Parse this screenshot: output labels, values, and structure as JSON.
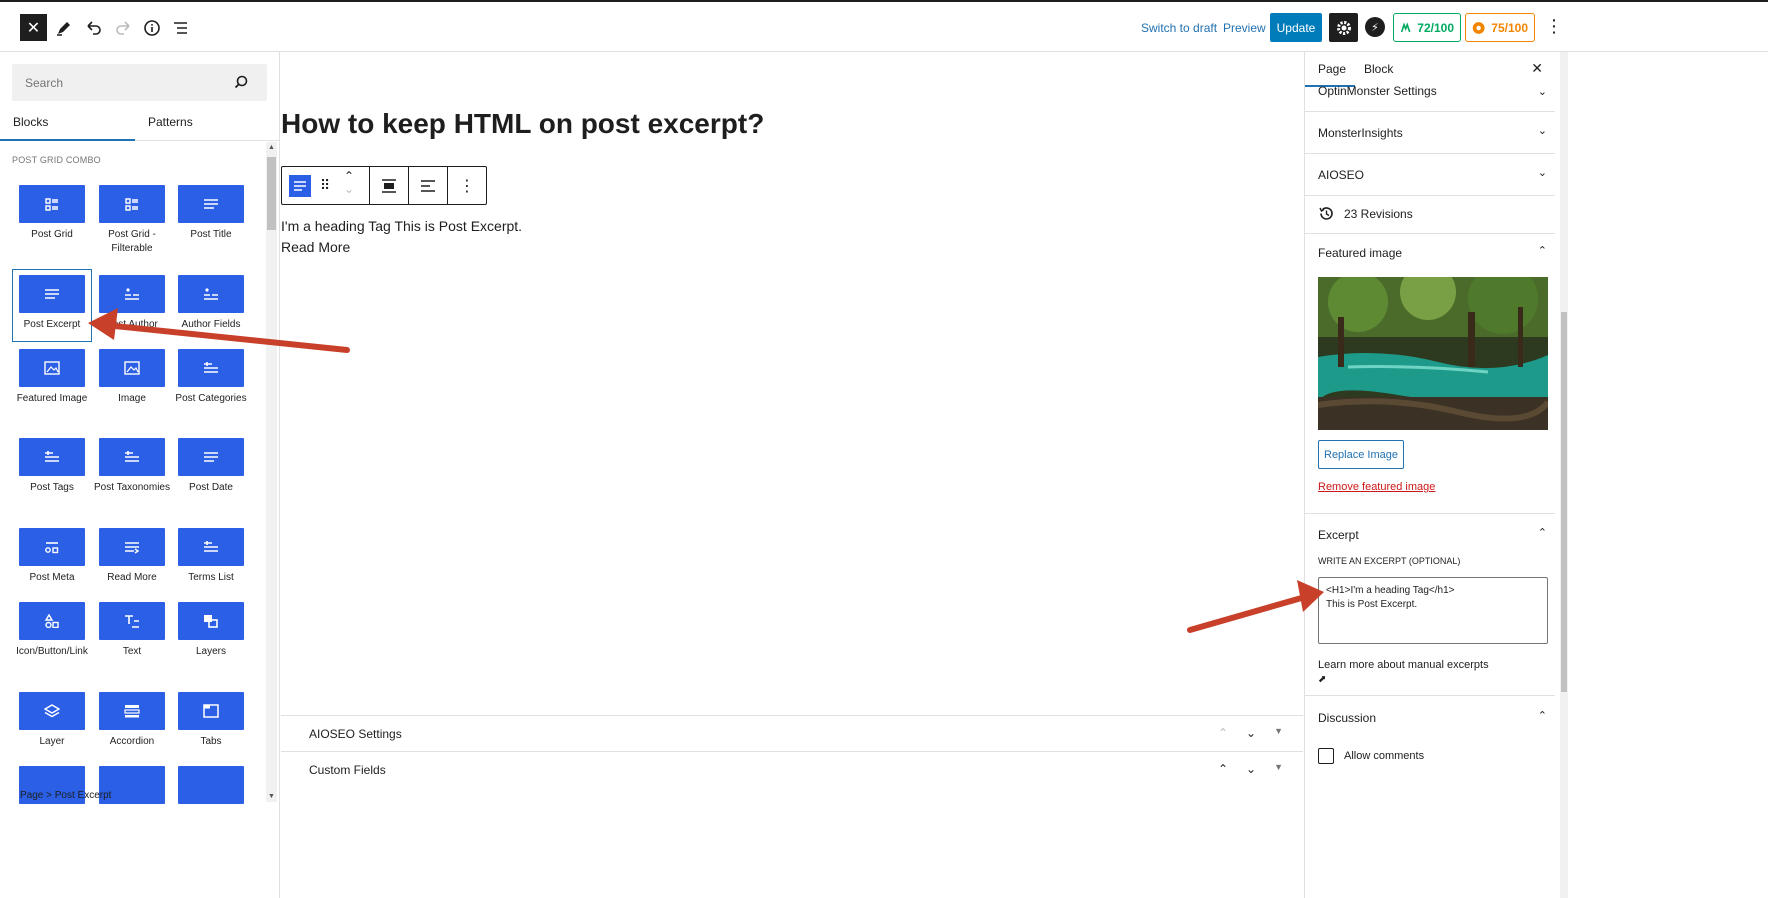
{
  "topbar": {
    "switch_draft": "Switch to draft",
    "preview": "Preview",
    "update": "Update",
    "score_seo": "72/100",
    "score_other": "75/100",
    "colors": {
      "accent": "#007cba",
      "seo_green": "#00aa63",
      "score_orange": "#f18500"
    }
  },
  "inserter": {
    "search_placeholder": "Search",
    "tabs": [
      "Blocks",
      "Patterns"
    ],
    "category": "POST GRID COMBO",
    "blocks": [
      {
        "label": "Post Grid",
        "icon": "grid-icon"
      },
      {
        "label": "Post Grid - Filterable",
        "icon": "grid-icon"
      },
      {
        "label": "Post Title",
        "icon": "lines-icon"
      },
      {
        "label": "Post Excerpt",
        "icon": "lines-icon"
      },
      {
        "label": "Post Author",
        "icon": "author-icon"
      },
      {
        "label": "Author Fields",
        "icon": "author-icon"
      },
      {
        "label": "Featured Image",
        "icon": "image-icon"
      },
      {
        "label": "Image",
        "icon": "image-icon"
      },
      {
        "label": "Post Categories",
        "icon": "short-lines-icon"
      },
      {
        "label": "Post Tags",
        "icon": "short-lines-icon"
      },
      {
        "label": "Post Taxonomies",
        "icon": "short-lines-icon"
      },
      {
        "label": "Post Date",
        "icon": "lines-icon"
      },
      {
        "label": "Post Meta",
        "icon": "meta-icon"
      },
      {
        "label": "Read More",
        "icon": "readmore-icon"
      },
      {
        "label": "Terms List",
        "icon": "short-lines-icon"
      },
      {
        "label": "Icon/Button/Link",
        "icon": "shapes-icon"
      },
      {
        "label": "Text",
        "icon": "text-icon"
      },
      {
        "label": "Layers",
        "icon": "layers-icon"
      },
      {
        "label": "Layer",
        "icon": "layer-icon"
      },
      {
        "label": "Accordion",
        "icon": "accordion-icon"
      },
      {
        "label": "Tabs",
        "icon": "tabs-icon"
      }
    ],
    "breadcrumb": "Page  >  Post Excerpt"
  },
  "editor": {
    "title": "How to keep HTML on post excerpt?",
    "excerpt_line1": "I'm a heading Tag This is Post Excerpt.",
    "excerpt_line2": "Read More",
    "meta_boxes": [
      "AIOSEO Settings",
      "Custom Fields"
    ]
  },
  "sidebar": {
    "tabs": [
      "Page",
      "Block"
    ],
    "panels": [
      "OptinMonster Settings",
      "MonsterInsights",
      "AIOSEO"
    ],
    "revisions": "23 Revisions",
    "featured_image_title": "Featured image",
    "replace_image": "Replace Image",
    "remove_image": "Remove featured image",
    "excerpt_title": "Excerpt",
    "excerpt_label": "WRITE AN EXCERPT (OPTIONAL)",
    "excerpt_value": "<H1>I'm a heading Tag</h1>\nThis is Post Excerpt.",
    "learn_more": "Learn more about manual excerpts",
    "discussion_title": "Discussion",
    "allow_comments": "Allow comments"
  }
}
